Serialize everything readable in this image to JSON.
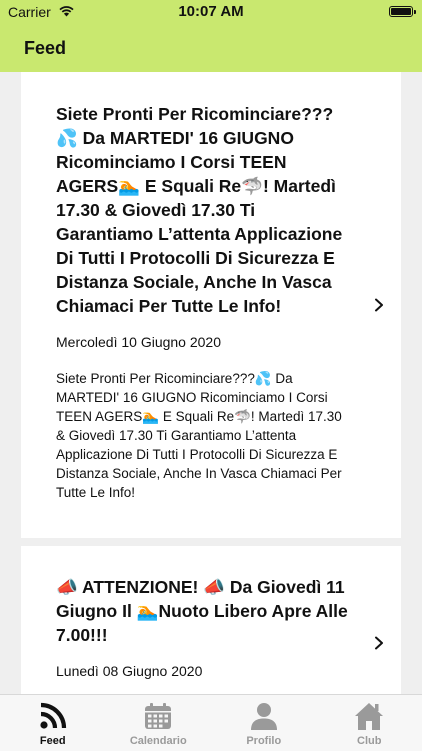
{
  "status": {
    "carrier": "Carrier",
    "time": "10:07 AM"
  },
  "header": {
    "title": "Feed"
  },
  "feed": [
    {
      "title": "Siete Pronti Per Ricominciare??? 💦 Da MARTEDI' 16 GIUGNO Ricominciamo I Corsi TEEN AGERS🏊 E Squali Re🦈! Martedì 17.30 & Giovedì 17.30 Ti Garantiamo L’attenta Applicazione Di Tutti I Protocolli Di Sicurezza E Distanza Sociale, Anche In Vasca Chiamaci Per Tutte Le Info!",
      "date": "Mercoledì 10 Giugno 2020",
      "body": "Siete Pronti Per Ricominciare???💦 Da MARTEDI' 16 GIUGNO Ricominciamo I Corsi TEEN AGERS🏊 E Squali Re🦈! Martedì 17.30 & Giovedì 17.30 Ti Garantiamo L’attenta Applicazione Di Tutti I Protocolli Di Sicurezza E Distanza Sociale, Anche In Vasca Chiamaci Per Tutte Le Info!"
    },
    {
      "title": "📣 ATTENZIONE! 📣 Da Giovedì 11 Giugno Il 🏊Nuoto Libero Apre Alle 7.00!!!",
      "date": "Lunedì 08 Giugno 2020"
    }
  ],
  "tabs": [
    {
      "label": "Feed",
      "icon": "rss-icon",
      "active": true
    },
    {
      "label": "Calendario",
      "icon": "calendar-icon",
      "active": false
    },
    {
      "label": "Profilo",
      "icon": "person-icon",
      "active": false
    },
    {
      "label": "Club",
      "icon": "house-icon",
      "active": false
    }
  ],
  "colors": {
    "bar": "#c9e86f",
    "active": "#111111",
    "inactive": "#9a9a9a"
  }
}
